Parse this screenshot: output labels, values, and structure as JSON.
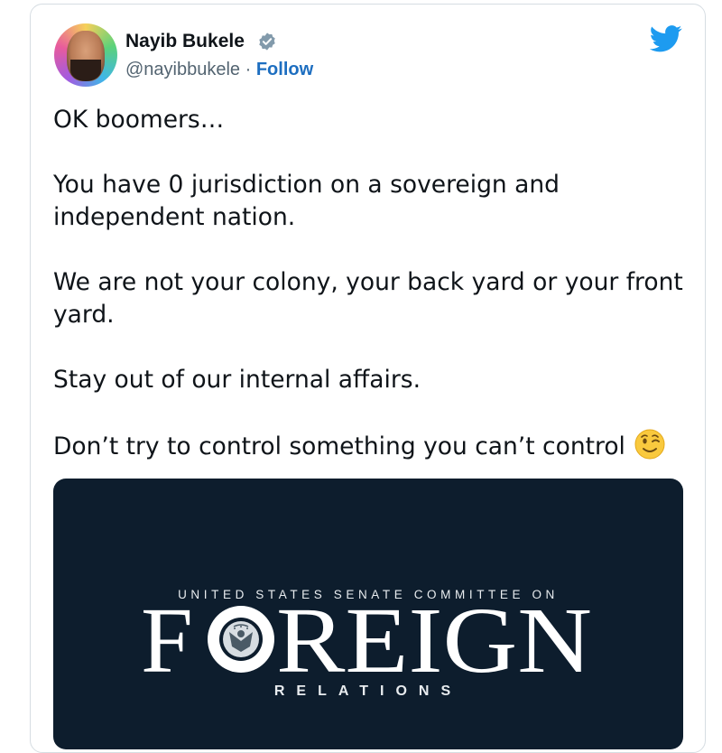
{
  "author": {
    "name": "Nayib Bukele",
    "handle": "@nayibbukele",
    "separator": " · ",
    "follow_label": "Follow",
    "verified_color": "#829aab",
    "twitter_color": "#1d9bf0"
  },
  "tweet": {
    "line1": "OK boomers…",
    "line2": "You have 0 jurisdiction on a sovereign and independent nation.",
    "line3": "We are not your colony, your back yard or your front yard.",
    "line4": "Stay out of our internal affairs.",
    "line5": "Don’t try to control something you can’t control",
    "emoji": "winking-face-emoji"
  },
  "media": {
    "background": "#0d1d2d",
    "top_line": "UNITED STATES SENATE COMMITTEE ON",
    "word_left": "F",
    "word_right": "REIGN",
    "bottom_line": "RELATIONS",
    "seal": "senate-seal-icon"
  }
}
